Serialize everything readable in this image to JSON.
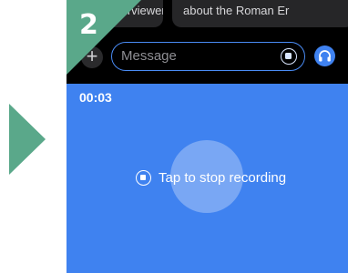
{
  "suggestions": [
    {
      "label": "terviewer"
    },
    {
      "label": "about the Roman Er"
    }
  ],
  "composer": {
    "plus_label": "+",
    "placeholder": "Message"
  },
  "step": {
    "number": "2"
  },
  "recording": {
    "timer": "00:03",
    "stop_label": "Tap to stop recording"
  },
  "colors": {
    "accent": "#3f82f0",
    "step_arrow": "#5aa88a"
  }
}
